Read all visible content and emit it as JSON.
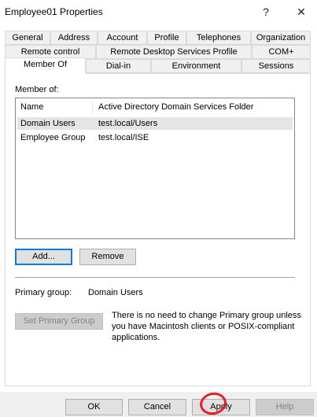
{
  "window": {
    "title": "Employee01 Properties",
    "help_glyph": "?",
    "close_glyph": "✕"
  },
  "tabs": {
    "row1": [
      "General",
      "Address",
      "Account",
      "Profile",
      "Telephones",
      "Organization"
    ],
    "row2": [
      "Remote control",
      "Remote Desktop Services Profile",
      "COM+"
    ],
    "row3": [
      "Member Of",
      "Dial-in",
      "Environment",
      "Sessions"
    ],
    "active": "Member Of"
  },
  "member_of": {
    "label": "Member of:",
    "columns": [
      "Name",
      "Active Directory Domain Services Folder"
    ],
    "rows": [
      {
        "name": "Domain Users",
        "folder": "test.local/Users"
      },
      {
        "name": "Employee Group",
        "folder": "test.local/ISE"
      }
    ]
  },
  "buttons": {
    "add": "Add...",
    "remove": "Remove",
    "set_primary": "Set Primary Group",
    "ok": "OK",
    "cancel": "Cancel",
    "apply": "Apply",
    "help": "Help"
  },
  "primary_group": {
    "label": "Primary group:",
    "value": "Domain Users",
    "note": "There is no need to change Primary group unless you have Macintosh clients or POSIX-compliant applications."
  },
  "annotation_color": "#e0202a"
}
